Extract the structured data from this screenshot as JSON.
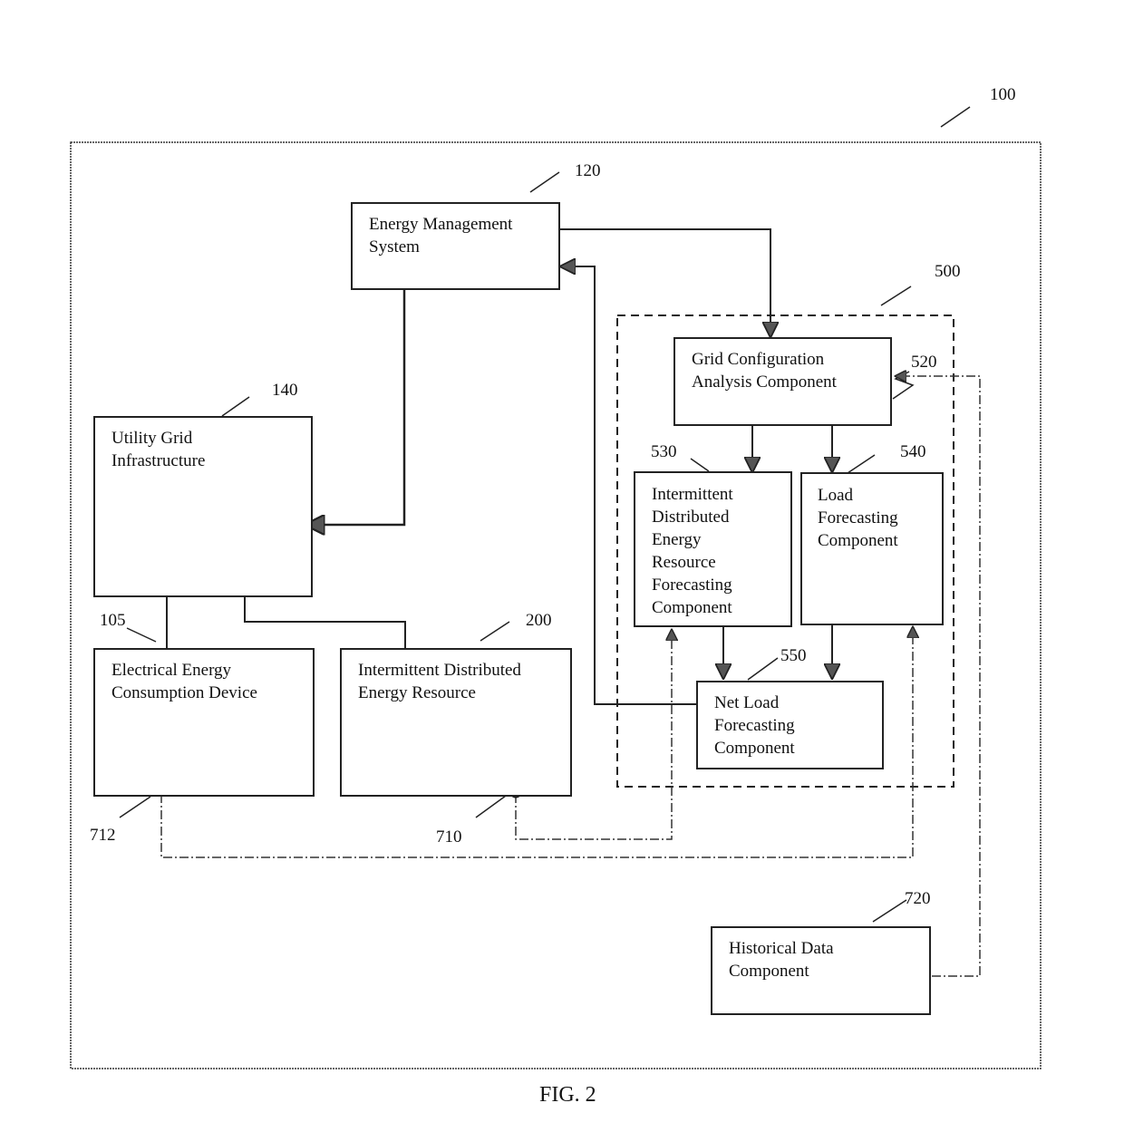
{
  "figure": {
    "caption": "FIG. 2",
    "system_ref": "100",
    "subsystem_ref": "500"
  },
  "blocks": {
    "ems": {
      "ref": "120",
      "label": "Energy Management\nSystem"
    },
    "grid": {
      "ref": "140",
      "label": "Utility Grid\nInfrastructure"
    },
    "device": {
      "ref": "105",
      "label": "Electrical Energy\nConsumption Device"
    },
    "ider": {
      "ref": "200",
      "label": "Intermittent Distributed\nEnergy Resource"
    },
    "gca": {
      "ref": "520",
      "label": "Grid Configuration\nAnalysis Component"
    },
    "iderf": {
      "ref": "530",
      "label": "Intermittent\nDistributed\nEnergy\nResource\nForecasting\nComponent"
    },
    "lfc": {
      "ref": "540",
      "label": "Load\nForecasting\nComponent"
    },
    "nlf": {
      "ref": "550",
      "label": "Net Load\nForecasting\nComponent"
    },
    "hist": {
      "ref": "720",
      "label": "Historical Data\nComponent"
    }
  },
  "sensors": {
    "device_sensor_ref": "712",
    "ider_sensor_ref": "710"
  }
}
